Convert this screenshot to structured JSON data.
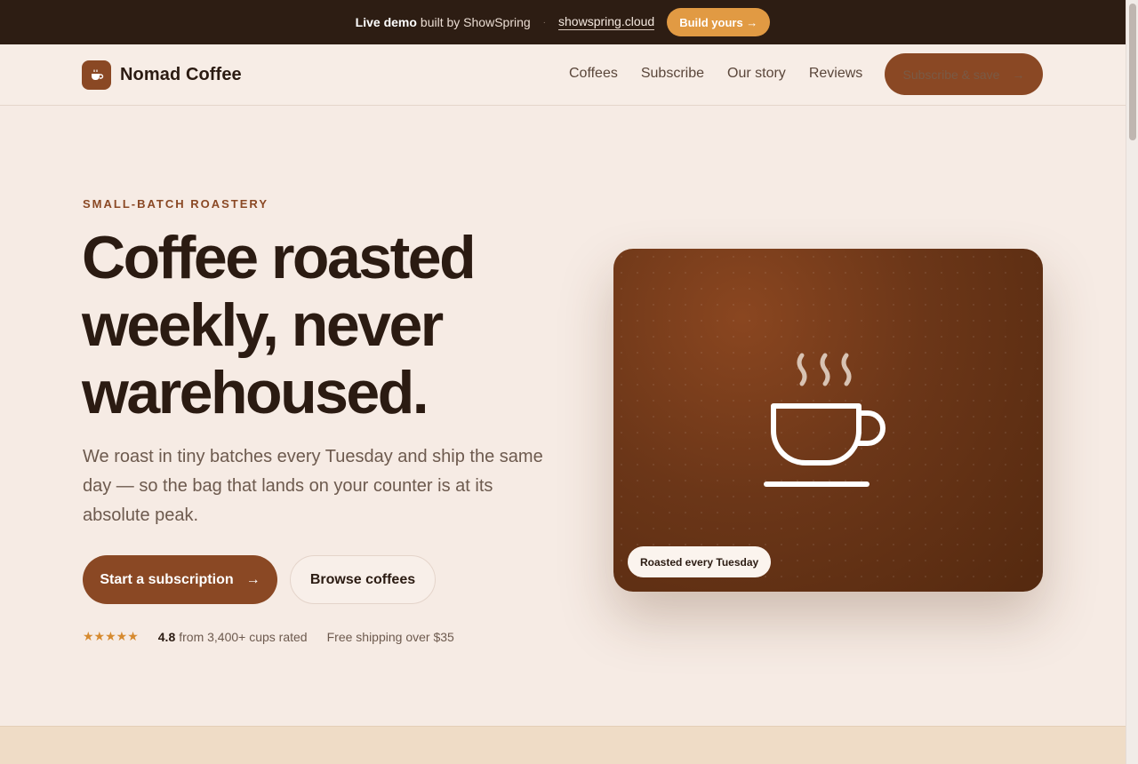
{
  "promo": {
    "live_demo": "Live demo",
    "built_by": "built by ShowSpring",
    "separator": "·",
    "link": "showspring.cloud",
    "build_button": "Build yours →"
  },
  "nav": {
    "brand": "Nomad Coffee",
    "links": [
      "Coffees",
      "Subscribe",
      "Our story",
      "Reviews"
    ],
    "cta": "Subscribe & save",
    "cta_arrow": "→"
  },
  "hero": {
    "eyebrow": "SMALL-BATCH ROASTERY",
    "headline": "Coffee roasted weekly, never warehoused.",
    "subtext": "We roast in tiny batches every Tuesday and ship the same day — so the bag that lands on your counter is at its absolute peak.",
    "primary_button": "Start a subscription",
    "primary_arrow": "→",
    "secondary_button": "Browse coffees",
    "stars": "★★★★★",
    "rating_score": "4.8",
    "rating_text": "from 3,400+ cups rated",
    "shipping": "Free shipping over $35",
    "card_badge": "Roasted every Tuesday"
  },
  "colors": {
    "brand": "#8a4824",
    "dark": "#2b1b12",
    "accent": "#e19a43",
    "background": "#f6ebe4"
  },
  "icons": {
    "logo": "coffee-cup-icon",
    "hero_art": "steaming-cup-icon"
  }
}
